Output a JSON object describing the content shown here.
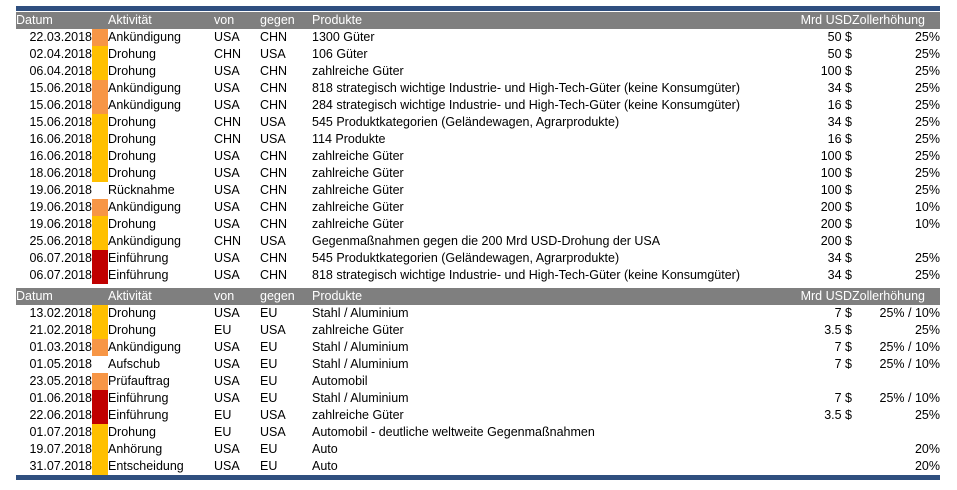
{
  "columns": {
    "datum": "Datum",
    "aktivitaet": "Aktivität",
    "von": "von",
    "gegen": "gegen",
    "produkte": "Produkte",
    "mrd_usd": "Mrd USD",
    "zoll": "Zollerhöhung"
  },
  "colors": {
    "header_bg": "#7f7f7f",
    "frame": "#2f4f7f",
    "drohung": "#ffc000",
    "ankuendigung": "#f79646",
    "einfuehrung": "#c00000"
  },
  "table_china": [
    {
      "datum": "22.03.2018",
      "swatch": "orange",
      "aktivitaet": "Ankündigung",
      "von": "USA",
      "gegen": "CHN",
      "produkte": "1300 Güter",
      "mrd": "50 $",
      "zoll": "25%"
    },
    {
      "datum": "02.04.2018",
      "swatch": "yellow",
      "aktivitaet": "Drohung",
      "von": "CHN",
      "gegen": "USA",
      "produkte": "106 Güter",
      "mrd": "50 $",
      "zoll": "25%"
    },
    {
      "datum": "06.04.2018",
      "swatch": "yellow",
      "aktivitaet": "Drohung",
      "von": "USA",
      "gegen": "CHN",
      "produkte": "zahlreiche Güter",
      "mrd": "100 $",
      "zoll": "25%"
    },
    {
      "datum": "15.06.2018",
      "swatch": "orange",
      "aktivitaet": "Ankündigung",
      "von": "USA",
      "gegen": "CHN",
      "produkte": "818 strategisch wichtige Industrie- und High-Tech-Güter (keine Konsumgüter)",
      "mrd": "34 $",
      "zoll": "25%"
    },
    {
      "datum": "15.06.2018",
      "swatch": "orange",
      "aktivitaet": "Ankündigung",
      "von": "USA",
      "gegen": "CHN",
      "produkte": "284 strategisch wichtige Industrie- und High-Tech-Güter (keine Konsumgüter)",
      "mrd": "16 $",
      "zoll": "25%"
    },
    {
      "datum": "15.06.2018",
      "swatch": "yellow",
      "aktivitaet": "Drohung",
      "von": "CHN",
      "gegen": "USA",
      "produkte": "545 Produktkategorien (Geländewagen, Agrarprodukte)",
      "mrd": "34 $",
      "zoll": "25%"
    },
    {
      "datum": "16.06.2018",
      "swatch": "yellow",
      "aktivitaet": "Drohung",
      "von": "CHN",
      "gegen": "USA",
      "produkte": "114 Produkte",
      "mrd": "16 $",
      "zoll": "25%"
    },
    {
      "datum": "16.06.2018",
      "swatch": "yellow",
      "aktivitaet": "Drohung",
      "von": "USA",
      "gegen": "CHN",
      "produkte": "zahlreiche Güter",
      "mrd": "100 $",
      "zoll": "25%"
    },
    {
      "datum": "18.06.2018",
      "swatch": "yellow",
      "aktivitaet": "Drohung",
      "von": "USA",
      "gegen": "CHN",
      "produkte": "zahlreiche Güter",
      "mrd": "100 $",
      "zoll": "25%"
    },
    {
      "datum": "19.06.2018",
      "swatch": "none",
      "aktivitaet": "Rücknahme",
      "von": "USA",
      "gegen": "CHN",
      "produkte": "zahlreiche Güter",
      "mrd": "100 $",
      "zoll": "25%"
    },
    {
      "datum": "19.06.2018",
      "swatch": "orange",
      "aktivitaet": "Ankündigung",
      "von": "USA",
      "gegen": "CHN",
      "produkte": "zahlreiche Güter",
      "mrd": "200 $",
      "zoll": "10%"
    },
    {
      "datum": "19.06.2018",
      "swatch": "yellow",
      "aktivitaet": "Drohung",
      "von": "USA",
      "gegen": "CHN",
      "produkte": "zahlreiche Güter",
      "mrd": "200 $",
      "zoll": "10%"
    },
    {
      "datum": "25.06.2018",
      "swatch": "yellow",
      "aktivitaet": "Ankündigung",
      "von": "CHN",
      "gegen": "USA",
      "produkte": "Gegenmaßnahmen gegen die 200 Mrd USD-Drohung der USA",
      "mrd": "200 $",
      "zoll": ""
    },
    {
      "datum": "06.07.2018",
      "swatch": "red",
      "aktivitaet": "Einführung",
      "von": "USA",
      "gegen": "CHN",
      "produkte": "545 Produktkategorien (Geländewagen, Agrarprodukte)",
      "mrd": "34 $",
      "zoll": "25%"
    },
    {
      "datum": "06.07.2018",
      "swatch": "red",
      "aktivitaet": "Einführung",
      "von": "USA",
      "gegen": "CHN",
      "produkte": "818 strategisch wichtige Industrie- und High-Tech-Güter (keine Konsumgüter)",
      "mrd": "34 $",
      "zoll": "25%"
    }
  ],
  "table_eu": [
    {
      "datum": "13.02.2018",
      "swatch": "yellow",
      "aktivitaet": "Drohung",
      "von": "USA",
      "gegen": "EU",
      "produkte": "Stahl / Aluminium",
      "mrd": "7 $",
      "zoll": "25%  /  10%"
    },
    {
      "datum": "21.02.2018",
      "swatch": "yellow",
      "aktivitaet": "Drohung",
      "von": "EU",
      "gegen": "USA",
      "produkte": "zahlreiche Güter",
      "mrd": "3.5 $",
      "zoll": "25%"
    },
    {
      "datum": "01.03.2018",
      "swatch": "orange",
      "aktivitaet": "Ankündigung",
      "von": "USA",
      "gegen": "EU",
      "produkte": "Stahl / Aluminium",
      "mrd": "7 $",
      "zoll": "25%  /  10%"
    },
    {
      "datum": "01.05.2018",
      "swatch": "none",
      "aktivitaet": "Aufschub",
      "von": "USA",
      "gegen": "EU",
      "produkte": "Stahl / Aluminium",
      "mrd": "7 $",
      "zoll": "25%  /  10%"
    },
    {
      "datum": "23.05.2018",
      "swatch": "orange",
      "aktivitaet": "Prüfauftrag",
      "von": "USA",
      "gegen": "EU",
      "produkte": "Automobil",
      "mrd": "",
      "zoll": ""
    },
    {
      "datum": "01.06.2018",
      "swatch": "red",
      "aktivitaet": "Einführung",
      "von": "USA",
      "gegen": "EU",
      "produkte": "Stahl / Aluminium",
      "mrd": "7 $",
      "zoll": "25%  /  10%"
    },
    {
      "datum": "22.06.2018",
      "swatch": "red",
      "aktivitaet": "Einführung",
      "von": "EU",
      "gegen": "USA",
      "produkte": "zahlreiche Güter",
      "mrd": "3.5 $",
      "zoll": "25%"
    },
    {
      "datum": "01.07.2018",
      "swatch": "yellow",
      "aktivitaet": "Drohung",
      "von": "EU",
      "gegen": "USA",
      "produkte": "Automobil - deutliche weltweite Gegenmaßnahmen",
      "mrd": "",
      "zoll": ""
    },
    {
      "datum": "19.07.2018",
      "swatch": "yellow",
      "aktivitaet": "Anhörung",
      "von": "USA",
      "gegen": "EU",
      "produkte": "Auto",
      "mrd": "",
      "zoll": "20%"
    },
    {
      "datum": "31.07.2018",
      "swatch": "yellow",
      "aktivitaet": "Entscheidung",
      "von": "USA",
      "gegen": "EU",
      "produkte": "Auto",
      "mrd": "",
      "zoll": "20%"
    }
  ]
}
